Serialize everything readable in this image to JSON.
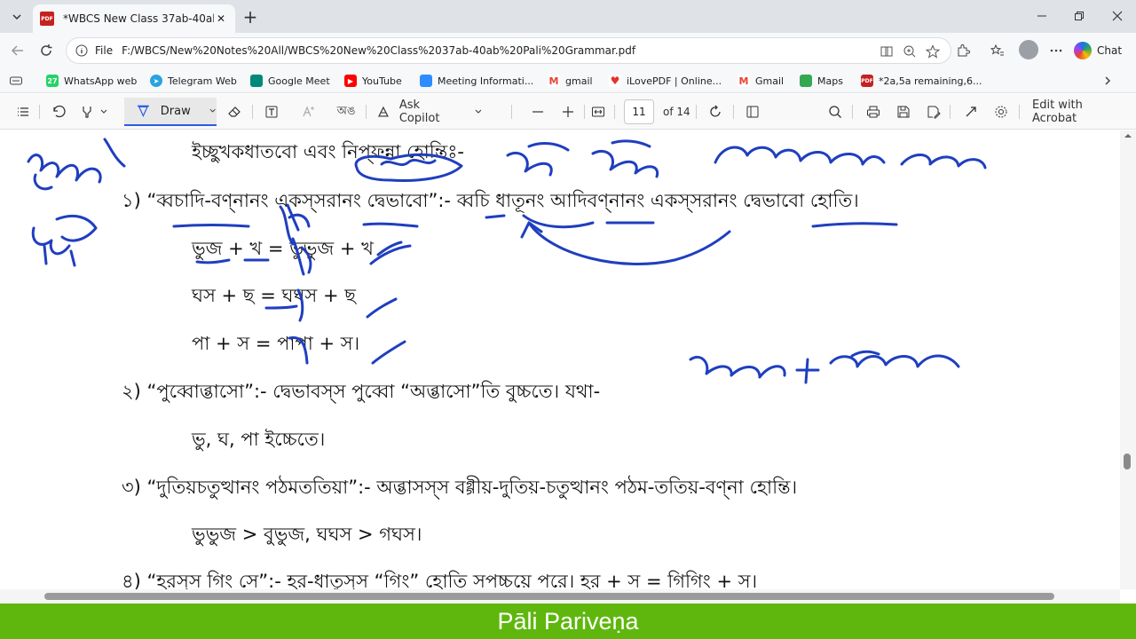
{
  "browser": {
    "tab_title": "*WBCS New Class 37ab-40ab Pali Grammar.pdf",
    "address_label": "File",
    "url": "F:/WBCS/New%20Notes%20All/WBCS%20New%20Class%2037ab-40ab%20Pali%20Grammar.pdf",
    "chat_label": "Chat"
  },
  "bookmarks": [
    {
      "label": "WhatsApp web",
      "icon": "whatsapp-icon",
      "color": "#25d366"
    },
    {
      "label": "Telegram Web",
      "icon": "telegram-icon",
      "color": "#2aa3de"
    },
    {
      "label": "Google Meet",
      "icon": "meet-icon",
      "color": "#00897b"
    },
    {
      "label": "YouTube",
      "icon": "youtube-icon",
      "color": "#ff0000"
    },
    {
      "label": "Meeting Informati...",
      "icon": "zoom-icon",
      "color": "#2d8cff"
    },
    {
      "label": "gmail",
      "icon": "gmail-icon",
      "color": "#ea4335"
    },
    {
      "label": "iLovePDF | Online...",
      "icon": "ilovepdf-icon",
      "color": "#e5322d"
    },
    {
      "label": "Gmail",
      "icon": "gmail-icon",
      "color": "#ea4335"
    },
    {
      "label": "Maps",
      "icon": "maps-icon",
      "color": "#34a853"
    },
    {
      "label": "*2a,5a remaining,6...",
      "icon": "pdf-icon",
      "color": "#c5221f"
    }
  ],
  "pdf_toolbar": {
    "draw_label": "Draw",
    "copilot_label": "Ask Copilot",
    "page_current": "11",
    "page_total": "of 14",
    "acrobat_label": "Edit with Acrobat"
  },
  "document": {
    "lines": [
      "ইচ্ছুখকধাতবো এবং নিপ্ফন্না হোন্তিঃ-",
      "১) “ব্বচাদি-বণ্নানং একস্সরানং দ্বেভাবো”:- ব্বচি ধাতূনং আদিবণ্নানং একস্সরানং দ্বেভাবো হোতি।",
      "ভুজ + খ = ভুভুজ + খ",
      "ঘস + ছ = ঘঘস + ছ",
      "পা + স = পাপা + স।",
      "২) “পুব্বোব্ভাসো”:- দ্বেভাবস্স পুব্বো “অব্ভাসো”তি বুচ্চতে। যথা-",
      "ভু, ঘ, পা ইচ্চেতে।",
      "৩) “দুতিয়চতুত্থানং পঠমততিয়া”:- অব্ভাসস্স বগ্গীয়-দুতিয়-চতুত্থানং পঠম-ততিয়-বণ্না হোন্তি।",
      "ভুভুজ > বুভুজ, ঘঘস > গঘস।",
      "৪) “হরস্স গিং সে”:- হর-ধাতুস্স “গিং” হোতি সপচ্চয়ে পরে। হর + স = গিগিং + স।"
    ]
  },
  "banner": {
    "text": "Pāli Pariveṇa",
    "color": "#5fb70e"
  },
  "ink_color": "#1f3fbf"
}
